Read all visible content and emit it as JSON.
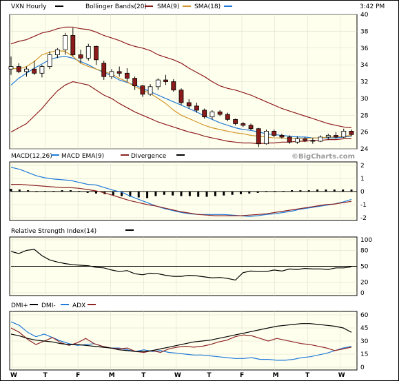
{
  "header": {
    "symbol_label": "VXN Hourly",
    "overlays": [
      {
        "label": "Bollinger Bands(20)",
        "color": "#8b1a1a"
      },
      {
        "label": "SMA(9)",
        "color": "#8b1a1a"
      },
      {
        "label": "SMA(18)",
        "color": "#d4962a"
      }
    ],
    "time": "3:42 PM"
  },
  "watermark": "©BigCharts.com",
  "colors": {
    "panel_bg": "#ffffee",
    "bb_band": "#8b1a1a",
    "sma9": "#8b1a1a",
    "sma18": "#d4962a",
    "blue": "#1f7ad8",
    "red": "#8b2323",
    "black": "#000000",
    "candle_up": "#ffffff",
    "candle_down": "#8b1a1a"
  },
  "chart_data": [
    {
      "type": "candlestick",
      "title": "VXN Hourly",
      "ylim": [
        24,
        40
      ],
      "yticks": [
        24,
        26,
        28,
        30,
        32,
        34,
        36,
        38,
        40
      ],
      "bollinger_upper": [
        36.5,
        36.8,
        37.0,
        37.4,
        37.8,
        38.0,
        38.3,
        38.5,
        38.5,
        38.3,
        38.2,
        37.9,
        37.5,
        37.2,
        36.9,
        36.5,
        36.2,
        36.0,
        35.7,
        35.2,
        34.9,
        34.6,
        34.2,
        33.6,
        33.1,
        32.6,
        32.0,
        31.5,
        31.2,
        31.0,
        30.7,
        30.4,
        30.0,
        29.6,
        29.2,
        28.8,
        28.5,
        28.2,
        27.9,
        27.6,
        27.3,
        27.0,
        26.8,
        26.6,
        26.5
      ],
      "bollinger_lower": [
        26.0,
        26.5,
        27.0,
        27.9,
        28.8,
        29.9,
        30.9,
        31.6,
        32.0,
        31.8,
        31.6,
        31.0,
        30.4,
        30.0,
        29.4,
        28.9,
        28.4,
        28.0,
        27.6,
        27.2,
        26.9,
        26.6,
        26.3,
        26.0,
        25.8,
        25.5,
        25.3,
        25.1,
        24.9,
        24.8,
        24.7,
        24.7,
        24.6,
        24.7,
        24.7,
        24.8,
        24.8,
        24.9,
        24.9,
        25.0,
        25.0,
        25.1,
        25.1,
        25.2,
        25.2
      ],
      "sma9": [
        33.6,
        33.5,
        33.8,
        34.4,
        35.2,
        35.5,
        35.7,
        35.6,
        35.0,
        34.2,
        33.8,
        33.5,
        33.2,
        32.9,
        32.4,
        32.0,
        31.4,
        31.0,
        30.6,
        30.0,
        29.4,
        28.6,
        28.0,
        27.6,
        27.2,
        26.8,
        26.5,
        26.3,
        26.1,
        25.9,
        25.8,
        25.6,
        25.5,
        25.4,
        25.3,
        25.3,
        25.2,
        25.2,
        25.2,
        25.3,
        25.3,
        25.4,
        25.4,
        25.5,
        25.6
      ],
      "sma18": [
        31.6,
        32.4,
        33.0,
        33.6,
        34.1,
        34.6,
        34.9,
        35.0,
        34.8,
        34.4,
        34.0,
        33.5,
        33.1,
        32.7,
        32.2,
        31.9,
        31.6,
        31.2,
        30.8,
        30.4,
        30.0,
        29.6,
        29.2,
        28.8,
        28.4,
        27.9,
        27.5,
        27.1,
        26.8,
        26.5,
        26.3,
        26.2,
        26.0,
        25.8,
        25.7,
        25.6,
        25.5,
        25.4,
        25.4,
        25.3,
        25.3,
        25.3,
        25.3,
        25.4,
        25.5
      ],
      "candles": [
        {
          "o": 33.5,
          "h": 35.0,
          "l": 32.8,
          "c": 33.8
        },
        {
          "o": 33.8,
          "h": 34.2,
          "l": 33.0,
          "c": 33.2
        },
        {
          "o": 33.2,
          "h": 33.8,
          "l": 32.6,
          "c": 33.5
        },
        {
          "o": 33.5,
          "h": 34.5,
          "l": 32.8,
          "c": 33.0
        },
        {
          "o": 33.0,
          "h": 34.0,
          "l": 32.5,
          "c": 33.8
        },
        {
          "o": 33.8,
          "h": 35.6,
          "l": 33.5,
          "c": 35.2
        },
        {
          "o": 35.2,
          "h": 36.0,
          "l": 34.8,
          "c": 35.8
        },
        {
          "o": 35.8,
          "h": 37.8,
          "l": 35.2,
          "c": 37.5
        },
        {
          "o": 37.5,
          "h": 38.4,
          "l": 35.0,
          "c": 35.2
        },
        {
          "o": 35.2,
          "h": 35.8,
          "l": 34.2,
          "c": 34.8
        },
        {
          "o": 34.8,
          "h": 36.5,
          "l": 34.5,
          "c": 36.2
        },
        {
          "o": 36.2,
          "h": 36.3,
          "l": 34.0,
          "c": 34.6
        },
        {
          "o": 34.2,
          "h": 34.5,
          "l": 32.2,
          "c": 32.6
        },
        {
          "o": 32.6,
          "h": 33.5,
          "l": 32.3,
          "c": 33.2
        },
        {
          "o": 33.2,
          "h": 33.8,
          "l": 32.6,
          "c": 33.0
        },
        {
          "o": 33.0,
          "h": 33.6,
          "l": 32.0,
          "c": 32.4
        },
        {
          "o": 32.4,
          "h": 32.6,
          "l": 31.0,
          "c": 31.5
        },
        {
          "o": 31.5,
          "h": 31.6,
          "l": 30.2,
          "c": 30.5
        },
        {
          "o": 30.5,
          "h": 31.7,
          "l": 30.3,
          "c": 31.4
        },
        {
          "o": 31.4,
          "h": 32.4,
          "l": 31.0,
          "c": 32.2
        },
        {
          "o": 32.2,
          "h": 32.8,
          "l": 31.6,
          "c": 32.0
        },
        {
          "o": 32.0,
          "h": 32.3,
          "l": 30.8,
          "c": 31.0
        },
        {
          "o": 31.0,
          "h": 31.2,
          "l": 29.2,
          "c": 29.5
        },
        {
          "o": 29.5,
          "h": 29.9,
          "l": 28.8,
          "c": 29.1
        },
        {
          "o": 29.1,
          "h": 29.5,
          "l": 28.3,
          "c": 28.6
        },
        {
          "o": 28.6,
          "h": 28.8,
          "l": 27.6,
          "c": 27.8
        },
        {
          "o": 27.8,
          "h": 28.6,
          "l": 27.5,
          "c": 28.4
        },
        {
          "o": 28.4,
          "h": 28.6,
          "l": 27.9,
          "c": 28.1
        },
        {
          "o": 28.1,
          "h": 28.3,
          "l": 27.3,
          "c": 27.5
        },
        {
          "o": 27.5,
          "h": 27.6,
          "l": 26.8,
          "c": 27.0
        },
        {
          "o": 27.0,
          "h": 27.2,
          "l": 26.6,
          "c": 26.8
        },
        {
          "o": 26.8,
          "h": 27.0,
          "l": 26.2,
          "c": 26.4
        },
        {
          "o": 26.4,
          "h": 26.5,
          "l": 24.2,
          "c": 24.6
        },
        {
          "o": 24.6,
          "h": 26.3,
          "l": 24.5,
          "c": 26.1
        },
        {
          "o": 26.1,
          "h": 26.3,
          "l": 25.4,
          "c": 25.6
        },
        {
          "o": 25.6,
          "h": 25.8,
          "l": 25.2,
          "c": 25.4
        },
        {
          "o": 25.4,
          "h": 25.6,
          "l": 24.6,
          "c": 24.8
        },
        {
          "o": 24.8,
          "h": 25.5,
          "l": 24.6,
          "c": 25.2
        },
        {
          "o": 25.2,
          "h": 25.4,
          "l": 24.8,
          "c": 25.0
        },
        {
          "o": 25.0,
          "h": 25.3,
          "l": 24.6,
          "c": 24.9
        },
        {
          "o": 24.9,
          "h": 25.6,
          "l": 24.8,
          "c": 25.4
        },
        {
          "o": 25.4,
          "h": 25.8,
          "l": 25.1,
          "c": 25.6
        },
        {
          "o": 25.6,
          "h": 26.0,
          "l": 25.2,
          "c": 25.4
        },
        {
          "o": 25.4,
          "h": 26.4,
          "l": 25.3,
          "c": 26.1
        },
        {
          "o": 26.1,
          "h": 26.3,
          "l": 25.5,
          "c": 25.7
        }
      ]
    },
    {
      "type": "line",
      "title": "MACD(12,26)",
      "legend": [
        {
          "label": "MACD EMA(9)",
          "color": "#1f7ad8"
        },
        {
          "label": "Divergence",
          "color": "#8b2323"
        }
      ],
      "ylim": [
        -2,
        2
      ],
      "yticks": [
        2,
        1,
        0,
        -1,
        -2
      ],
      "series": [
        {
          "name": "MACD EMA(9)",
          "values": [
            1.85,
            1.7,
            1.45,
            1.2,
            1.05,
            0.95,
            0.9,
            0.85,
            0.7,
            0.55,
            0.5,
            0.3,
            0.1,
            -0.05,
            -0.35,
            -0.6,
            -0.85,
            -1.1,
            -1.3,
            -1.45,
            -1.6,
            -1.7,
            -1.75,
            -1.75,
            -1.75,
            -1.75,
            -1.8,
            -1.85,
            -1.9,
            -1.85,
            -1.75,
            -1.7,
            -1.6,
            -1.5,
            -1.35,
            -1.25,
            -1.15,
            -1.05,
            -0.95,
            -0.8,
            -0.6
          ]
        },
        {
          "name": "Divergence",
          "values": [
            0.55,
            0.55,
            0.5,
            0.45,
            0.4,
            0.35,
            0.3,
            0.3,
            0.25,
            0.15,
            0.05,
            -0.1,
            -0.3,
            -0.5,
            -0.7,
            -0.85,
            -1.0,
            -1.1,
            -1.25,
            -1.4,
            -1.55,
            -1.65,
            -1.75,
            -1.8,
            -1.85,
            -1.85,
            -1.85,
            -1.85,
            -1.8,
            -1.75,
            -1.7,
            -1.6,
            -1.5,
            -1.4,
            -1.3,
            -1.2,
            -1.1,
            -1.0,
            -0.95,
            -0.85,
            -0.75
          ]
        },
        {
          "name": "Histogram",
          "values": [
            0.2,
            0.15,
            0.1,
            -0.05,
            0.05,
            0.05,
            0.1,
            0.1,
            0.05,
            -0.1,
            -0.15,
            -0.2,
            -0.3,
            -0.35,
            -0.4,
            -0.45,
            -0.5,
            -0.35,
            -0.25,
            -0.3,
            -0.35,
            -0.35,
            -0.4,
            -0.4,
            -0.35,
            -0.3,
            -0.25,
            -0.2,
            -0.15,
            -0.1,
            -0.05,
            0.0,
            0.05,
            0.1,
            0.1,
            0.1,
            0.15,
            0.15,
            0.15,
            0.15,
            0.15
          ]
        }
      ]
    },
    {
      "type": "line",
      "title": "Relative Strength Index(14)",
      "ylim": [
        0,
        100
      ],
      "yticks": [
        100,
        80,
        50,
        20,
        0
      ],
      "reference_line": 50,
      "series": [
        {
          "name": "RSI",
          "values": [
            78,
            74,
            80,
            82,
            70,
            62,
            58,
            55,
            53,
            52,
            51,
            48,
            47,
            43,
            40,
            42,
            36,
            34,
            37,
            36,
            33,
            31,
            31,
            33,
            32,
            30,
            28,
            29,
            27,
            24,
            38,
            41,
            40,
            40,
            43,
            41,
            45,
            44,
            46,
            45,
            45,
            44,
            47,
            47,
            49
          ]
        }
      ]
    },
    {
      "type": "line",
      "title": "DMI+",
      "legend": [
        {
          "label": "DMI-",
          "color": "#1f7ad8"
        },
        {
          "label": "ADX",
          "color": "#8b2323"
        }
      ],
      "ylim": [
        0,
        60
      ],
      "yticks": [
        60,
        45,
        30,
        15,
        0
      ],
      "series": [
        {
          "name": "DMI-",
          "values": [
            52,
            48,
            40,
            35,
            38,
            34,
            30,
            27,
            25,
            26,
            27,
            24,
            22,
            22,
            20,
            18,
            20,
            18,
            19,
            17,
            16,
            15,
            14,
            14,
            13,
            12,
            11,
            10,
            10,
            11,
            9,
            9,
            8,
            8,
            9,
            11,
            12,
            14,
            16,
            19,
            22,
            24
          ]
        },
        {
          "name": "ADX",
          "values": [
            45,
            40,
            32,
            26,
            30,
            34,
            28,
            25,
            28,
            33,
            27,
            24,
            22,
            21,
            22,
            18,
            17,
            19,
            17,
            21,
            23,
            24,
            23,
            24,
            26,
            29,
            31,
            35,
            37,
            36,
            33,
            30,
            33,
            31,
            29,
            27,
            26,
            24,
            22,
            19,
            21,
            23
          ]
        },
        {
          "name": "DMI+",
          "values": [
            38,
            36,
            33,
            31,
            30,
            29,
            27,
            26,
            26,
            25,
            24,
            23,
            22,
            20,
            19,
            18,
            18,
            19,
            21,
            23,
            25,
            27,
            29,
            30,
            31,
            33,
            35,
            37,
            39,
            41,
            43,
            45,
            47,
            48,
            49,
            50,
            50,
            49,
            48,
            47,
            45,
            40
          ]
        }
      ]
    }
  ],
  "x_axis": {
    "day_labels": [
      "W",
      "T",
      "F",
      "M",
      "T",
      "W",
      "T",
      "F",
      "M",
      "T",
      "W"
    ]
  }
}
